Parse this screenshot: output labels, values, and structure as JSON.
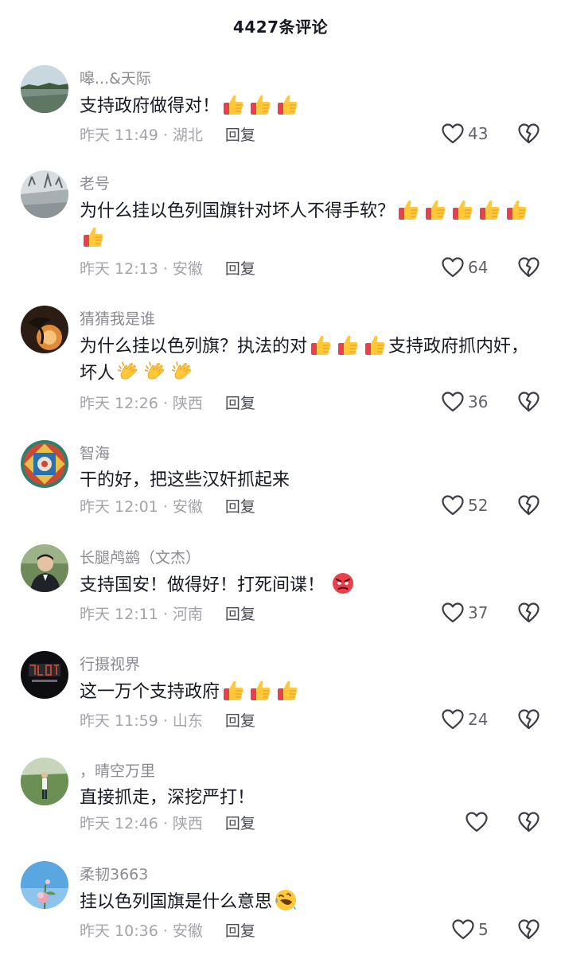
{
  "header": {
    "title": "4427条评论"
  },
  "comments": [
    {
      "username": "嗥...&天际",
      "text": "支持政府做得对！",
      "time": "昨天 11:49 · 湖北",
      "likes": "43",
      "reply": "回复"
    },
    {
      "username": "老号",
      "text": "为什么挂以色列国旗针对坏人不得手软？",
      "time": "昨天 12:13 · 安徽",
      "likes": "64",
      "reply": "回复"
    },
    {
      "username": "猜猜我是谁",
      "text_a": "为什么挂以色列旗？执法的对",
      "text_b": "支持政府抓内奸，坏人",
      "time": "昨天 12:26 · 陕西",
      "likes": "36",
      "reply": "回复"
    },
    {
      "username": "智海",
      "text": "干的好，把这些汉奸抓起来",
      "time": "昨天 12:01 · 安徽",
      "likes": "52",
      "reply": "回复"
    },
    {
      "username": "长腿鸬鹚（文杰）",
      "text": "支持国安！做得好！打死间谍！",
      "time": "昨天 12:11 · 河南",
      "likes": "37",
      "reply": "回复"
    },
    {
      "username": "行摄视界",
      "text": "这一万个支持政府",
      "time": "昨天 11:59 · 山东",
      "likes": "24",
      "reply": "回复"
    },
    {
      "username": "，晴空万里",
      "text": "直接抓走，深挖严打！",
      "time": "昨天 12:46 · 陕西",
      "likes": "",
      "reply": "回复"
    },
    {
      "username": "柔韧3663",
      "text": "挂以色列国旗是什么意思",
      "time": "昨天 10:36 · 安徽",
      "likes": "5",
      "reply": "回复"
    }
  ],
  "icons": {
    "like": "heart-outline-icon",
    "dislike": "broken-heart-icon",
    "emoji_thumbs": "thumbs-up-emoji",
    "emoji_clap": "clapping-hands-emoji",
    "emoji_angry": "angry-face-emoji",
    "emoji_laugh": "rolling-laughing-emoji"
  },
  "colors": {
    "text": "#161823",
    "secondary": "#8a8b91",
    "meta": "#a3a4aa",
    "background": "#ffffff"
  }
}
